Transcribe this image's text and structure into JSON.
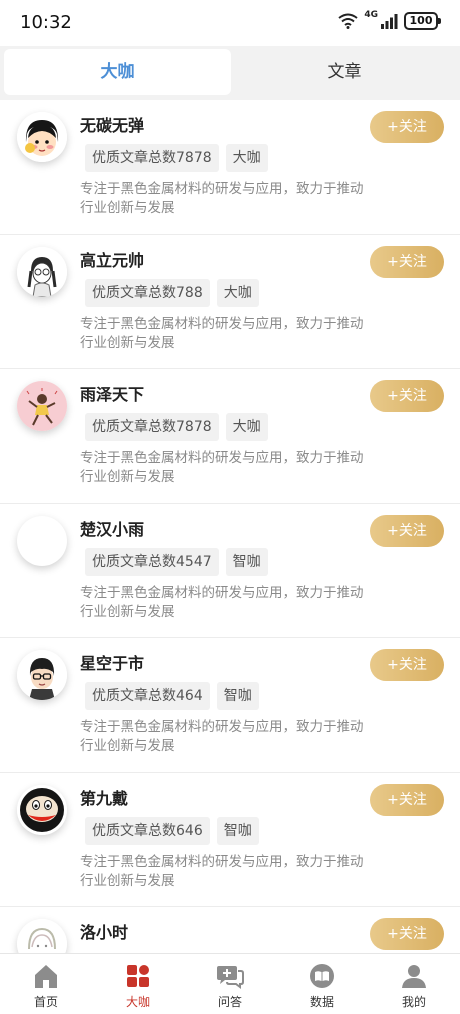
{
  "status_bar": {
    "time": "10:32",
    "network": "4G",
    "battery": "100"
  },
  "tabs": [
    {
      "label": "大咖",
      "active": true
    },
    {
      "label": "文章",
      "active": false
    }
  ],
  "follow_label": "+关注",
  "experts": [
    {
      "name": "无碳无弹",
      "article_count": "优质文章总数7878",
      "badge": "大咖",
      "description": "专注于黑色金属材料的研发与应用，致力于推动行业创新与发展",
      "avatar": "cartoon-girl-headband"
    },
    {
      "name": "高立元帅",
      "article_count": "优质文章总数788",
      "badge": "大咖",
      "description": "专注于黑色金属材料的研发与应用，致力于推动行业创新与发展",
      "avatar": "sketch-girl-braids"
    },
    {
      "name": "雨泽天下",
      "article_count": "优质文章总数7878",
      "badge": "大咖",
      "description": "专注于黑色金属材料的研发与应用，致力于推动行业创新与发展",
      "avatar": "dancing-girl-pink"
    },
    {
      "name": "楚汉小雨",
      "article_count": "优质文章总数4547",
      "badge": "智咖",
      "description": "专注于黑色金属材料的研发与应用，致力于推动行业创新与发展",
      "avatar": "blank"
    },
    {
      "name": "星空于市",
      "article_count": "优质文章总数464",
      "badge": "智咖",
      "description": "专注于黑色金属材料的研发与应用，致力于推动行业创新与发展",
      "avatar": "cartoon-boy-glasses"
    },
    {
      "name": "第九戴",
      "article_count": "优质文章总数646",
      "badge": "智咖",
      "description": "专注于黑色金属材料的研发与应用，致力于推动行业创新与发展",
      "avatar": "monkey-face"
    },
    {
      "name": "洛小时",
      "article_count": "",
      "badge": "",
      "description": "",
      "avatar": "sketch-girl"
    }
  ],
  "bottom_nav": [
    {
      "label": "首页",
      "icon": "home-icon",
      "active": false
    },
    {
      "label": "大咖",
      "icon": "grid-icon",
      "active": true
    },
    {
      "label": "问答",
      "icon": "chat-plus-icon",
      "active": false
    },
    {
      "label": "数据",
      "icon": "book-icon",
      "active": false
    },
    {
      "label": "我的",
      "icon": "user-icon",
      "active": false
    }
  ],
  "colors": {
    "accent_blue": "#4d8fd6",
    "follow_gold": "#d9b062",
    "nav_active": "#c8352a"
  }
}
